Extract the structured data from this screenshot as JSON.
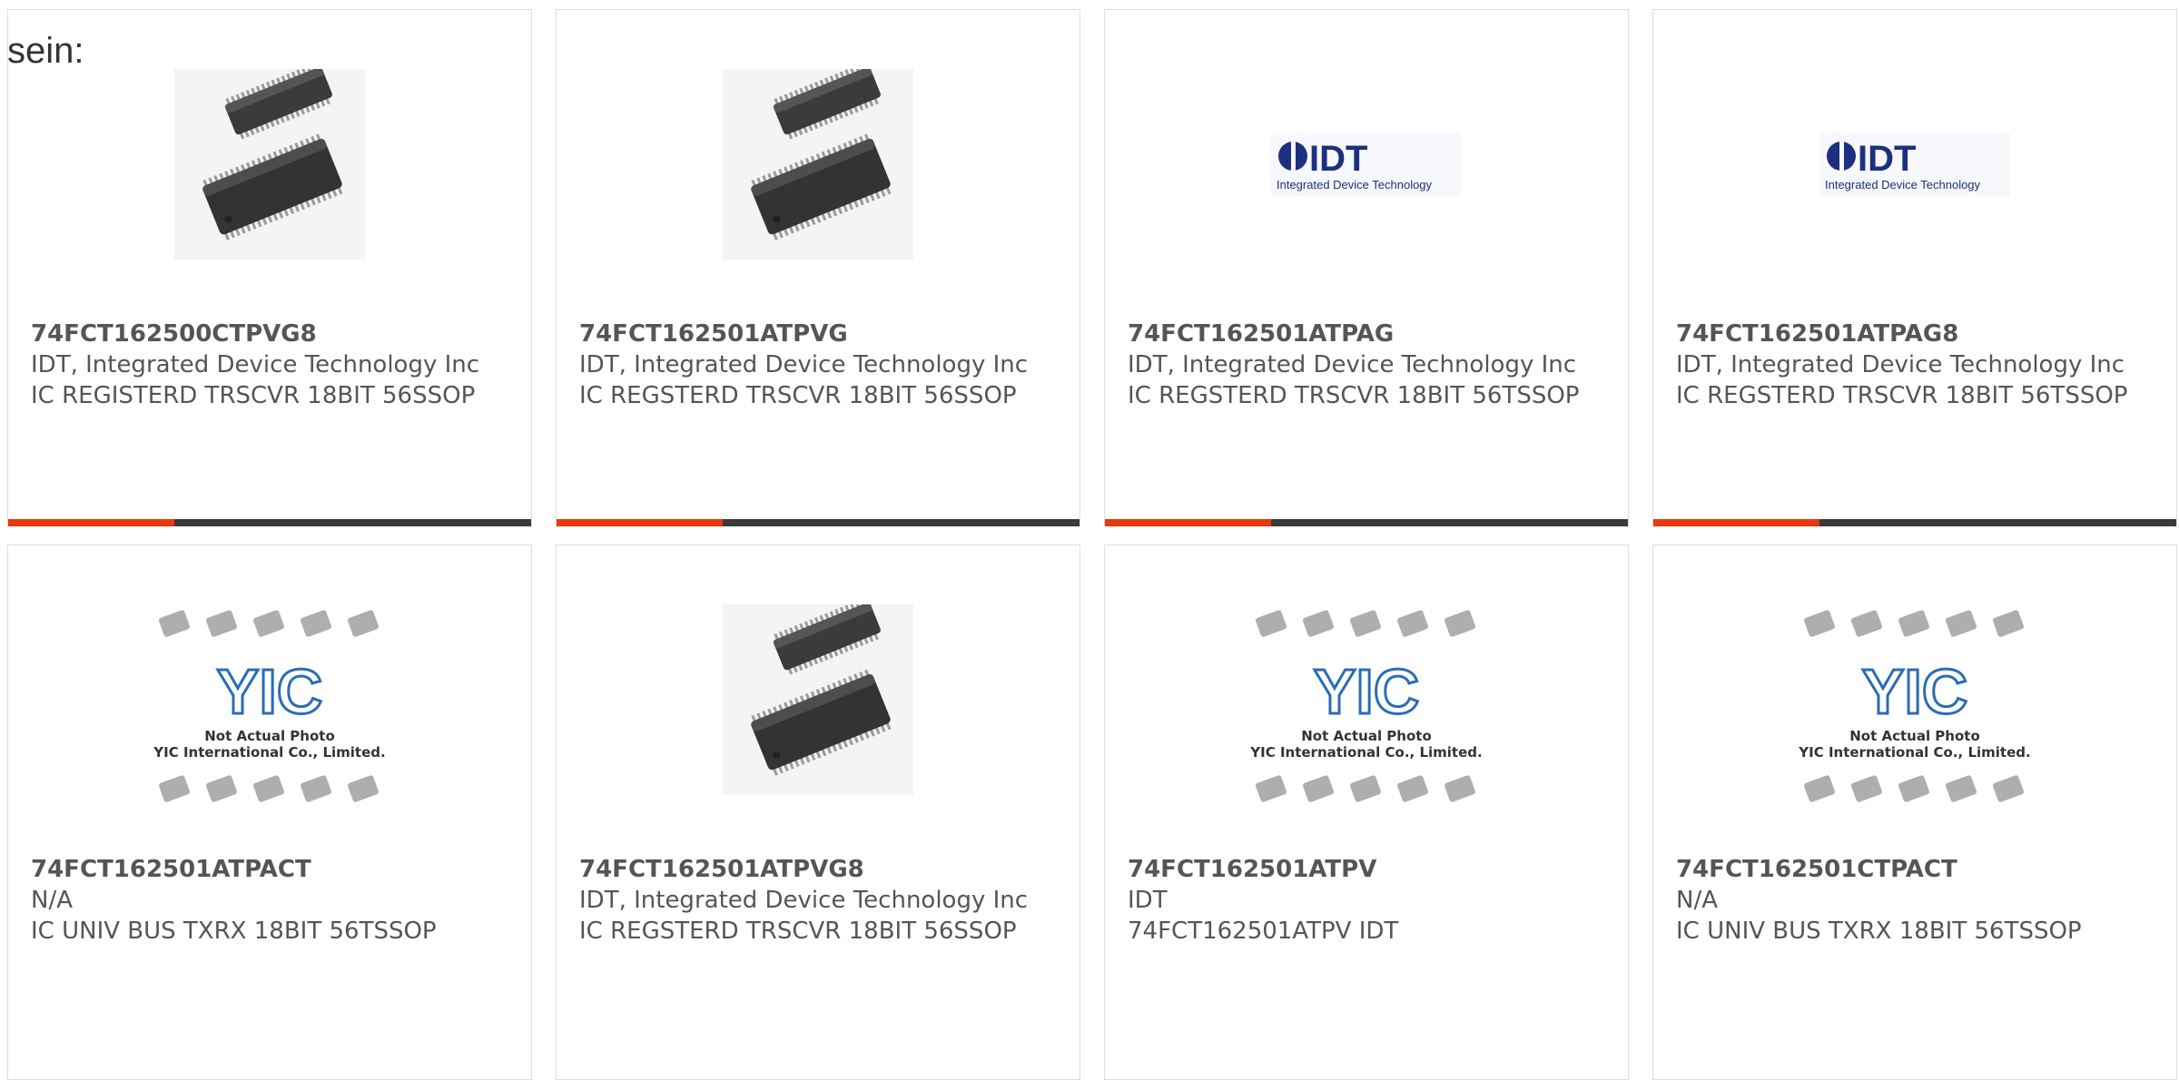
{
  "heading": "sein:",
  "accent_color": "#e8380d",
  "bar_color": "#3a3a3a",
  "cards": [
    {
      "part": "74FCT162500CTPVG8",
      "mfr": "IDT, Integrated Device Technology Inc",
      "desc": "IC REGISTERD TRSCVR 18BIT 56SSOP",
      "image": "chip-photo"
    },
    {
      "part": "74FCT162501ATPVG",
      "mfr": "IDT, Integrated Device Technology Inc",
      "desc": "IC REGSTERD TRSCVR 18BIT 56SSOP",
      "image": "chip-photo"
    },
    {
      "part": "74FCT162501ATPAG",
      "mfr": "IDT, Integrated Device Technology Inc",
      "desc": "IC REGSTERD TRSCVR 18BIT 56TSSOP",
      "image": "idt-logo",
      "logo_text": "IDT",
      "logo_sub": "Integrated Device Technology"
    },
    {
      "part": "74FCT162501ATPAG8",
      "mfr": "IDT, Integrated Device Technology Inc",
      "desc": "IC REGSTERD TRSCVR 18BIT 56TSSOP",
      "image": "idt-logo",
      "logo_text": "IDT",
      "logo_sub": "Integrated Device Technology"
    },
    {
      "part": "74FCT162501ATPACT",
      "mfr": "N/A",
      "desc": "IC UNIV BUS TXRX 18BIT 56TSSOP",
      "image": "placeholder",
      "placeholder_line1": "Not Actual Photo",
      "placeholder_line2": "YIC International Co., Limited.",
      "logo_text": "YIC"
    },
    {
      "part": "74FCT162501ATPVG8",
      "mfr": "IDT, Integrated Device Technology Inc",
      "desc": "IC REGSTERD TRSCVR 18BIT 56SSOP",
      "image": "chip-photo"
    },
    {
      "part": "74FCT162501ATPV",
      "mfr": "IDT",
      "desc": "74FCT162501ATPV IDT",
      "image": "placeholder",
      "placeholder_line1": "Not Actual Photo",
      "placeholder_line2": "YIC International Co., Limited.",
      "logo_text": "YIC"
    },
    {
      "part": "74FCT162501CTPACT",
      "mfr": "N/A",
      "desc": "IC UNIV BUS TXRX 18BIT 56TSSOP",
      "image": "placeholder",
      "placeholder_line1": "Not Actual Photo",
      "placeholder_line2": "YIC International Co., Limited.",
      "logo_text": "YIC"
    }
  ]
}
